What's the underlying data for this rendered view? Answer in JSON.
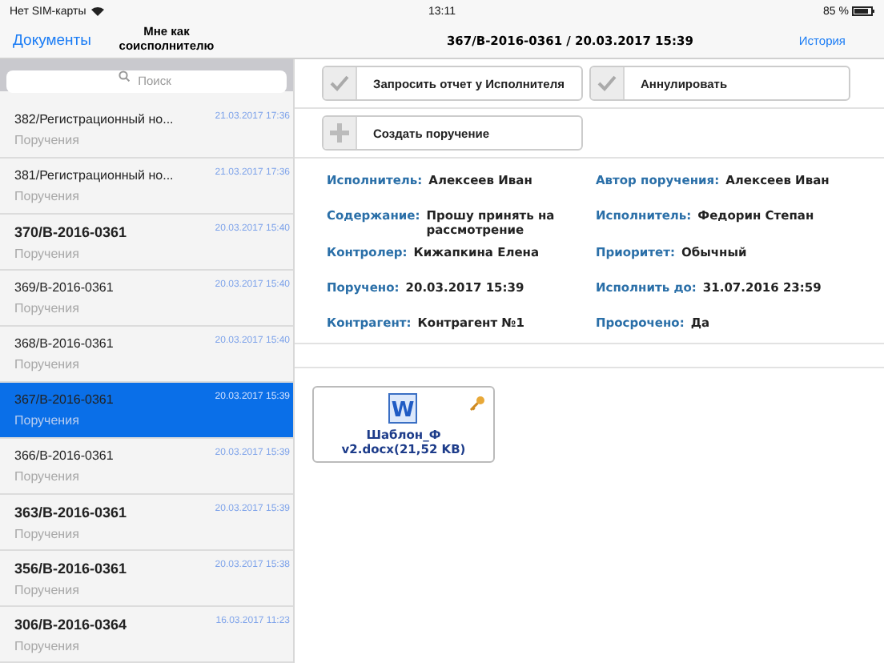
{
  "status_bar": {
    "carrier": "Нет SIM-карты",
    "time": "13:11",
    "battery": "85 %"
  },
  "nav": {
    "back": "Документы",
    "section": "Мне как соисполнителю",
    "title": "367/В-2016-0361 / 20.03.2017 15:39",
    "history": "История"
  },
  "search": {
    "placeholder": "Поиск"
  },
  "list": [
    {
      "title": "382/Регистрационный но...",
      "date": "21.03.2017 17:36",
      "subtitle": "Поручения",
      "unread": false,
      "selected": false
    },
    {
      "title": "381/Регистрационный но...",
      "date": "21.03.2017 17:36",
      "subtitle": "Поручения",
      "unread": false,
      "selected": false
    },
    {
      "title": "370/В-2016-0361",
      "date": "20.03.2017 15:40",
      "subtitle": "Поручения",
      "unread": true,
      "selected": false
    },
    {
      "title": "369/В-2016-0361",
      "date": "20.03.2017 15:40",
      "subtitle": "Поручения",
      "unread": false,
      "selected": false
    },
    {
      "title": "368/В-2016-0361",
      "date": "20.03.2017 15:40",
      "subtitle": "Поручения",
      "unread": false,
      "selected": false
    },
    {
      "title": "367/В-2016-0361",
      "date": "20.03.2017 15:39",
      "subtitle": "Поручения",
      "unread": false,
      "selected": true
    },
    {
      "title": "366/В-2016-0361",
      "date": "20.03.2017 15:39",
      "subtitle": "Поручения",
      "unread": false,
      "selected": false
    },
    {
      "title": "363/В-2016-0361",
      "date": "20.03.2017 15:39",
      "subtitle": "Поручения",
      "unread": true,
      "selected": false
    },
    {
      "title": "356/В-2016-0361",
      "date": "20.03.2017 15:38",
      "subtitle": "Поручения",
      "unread": true,
      "selected": false
    },
    {
      "title": "306/В-2016-0364",
      "date": "16.03.2017 11:23",
      "subtitle": "Поручения",
      "unread": true,
      "selected": false
    }
  ],
  "actions": [
    [
      {
        "label": "Запросить отчет у Исполнителя",
        "kind": "check"
      },
      {
        "label": "Аннулировать",
        "kind": "check"
      }
    ],
    [
      {
        "label": "Создать поручение",
        "kind": "plus"
      }
    ]
  ],
  "details": [
    [
      {
        "key": "Исполнитель:",
        "value": "Алексеев Иван"
      },
      {
        "key": "Автор поручения:",
        "value": "Алексеев Иван"
      }
    ],
    [
      {
        "key": "Содержание:",
        "value": "Прошу принять на рассмотрение"
      },
      {
        "key": "Исполнитель:",
        "value": "Федорин Степан"
      }
    ],
    [
      {
        "key": "Контролер:",
        "value": "Кижапкина Елена"
      },
      {
        "key": "Приоритет:",
        "value": "Обычный"
      }
    ],
    [
      {
        "key": "Поручено:",
        "value": "20.03.2017 15:39"
      },
      {
        "key": "Исполнить до:",
        "value": "31.07.2016 23:59"
      }
    ],
    [
      {
        "key": "Контрагент:",
        "value": "Контрагент №1"
      },
      {
        "key": "Просрочено:",
        "value": "Да"
      }
    ]
  ],
  "attachments": [
    {
      "name": "Шаблон_Ф v2.docx(21,52 KB)",
      "icon_letter": "W",
      "locked": true
    }
  ]
}
